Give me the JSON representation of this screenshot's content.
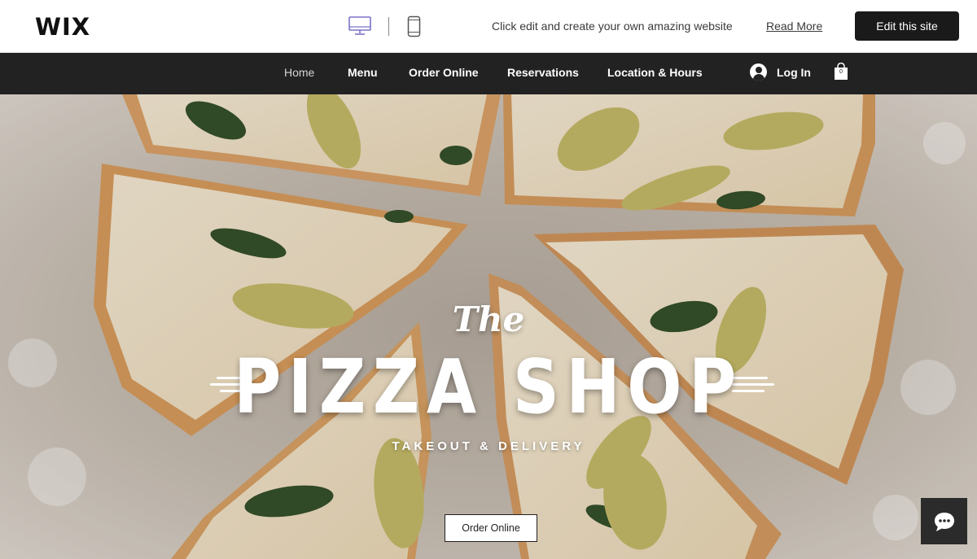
{
  "wixbar": {
    "logo": "WIX",
    "promo_text": "Click edit and create your own amazing website",
    "read_more": "Read More",
    "edit_button": "Edit this site",
    "device_icons": [
      "desktop-icon",
      "mobile-icon"
    ]
  },
  "nav": {
    "items": [
      {
        "label": "Home",
        "active": true
      },
      {
        "label": "Menu"
      },
      {
        "label": "Order Online"
      },
      {
        "label": "Reservations"
      },
      {
        "label": "Location & Hours"
      }
    ],
    "login": "Log In",
    "cart_count": "0"
  },
  "hero": {
    "the": "The",
    "title": "PIZZA SHOP",
    "subtitle": "TAKEOUT & DELIVERY",
    "cta": "Order Online"
  },
  "colors": {
    "navbar_bg": "#222222",
    "edit_button_bg": "#1a1a1a",
    "device_icon_active": "#7b73c9"
  }
}
